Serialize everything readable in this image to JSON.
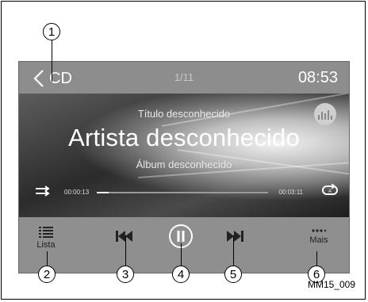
{
  "header": {
    "source_label": "CD",
    "track_counter": "1/11",
    "clock": "08:53"
  },
  "now_playing": {
    "title": "Título desconhecido",
    "artist": "Artista desconhecido",
    "album": "Álbum desconhecido",
    "elapsed": "00:00:13",
    "total": "00:03:11",
    "progress": 0.07
  },
  "controls": {
    "list_label": "Lista",
    "more_label": "Mais"
  },
  "callouts": [
    "1",
    "2",
    "3",
    "4",
    "5",
    "6"
  ],
  "figure_code": "MM15_009",
  "colors": {
    "screen_bar": "#8d8d8d",
    "text_light": "#ffffff",
    "icon_dark": "#222222"
  }
}
